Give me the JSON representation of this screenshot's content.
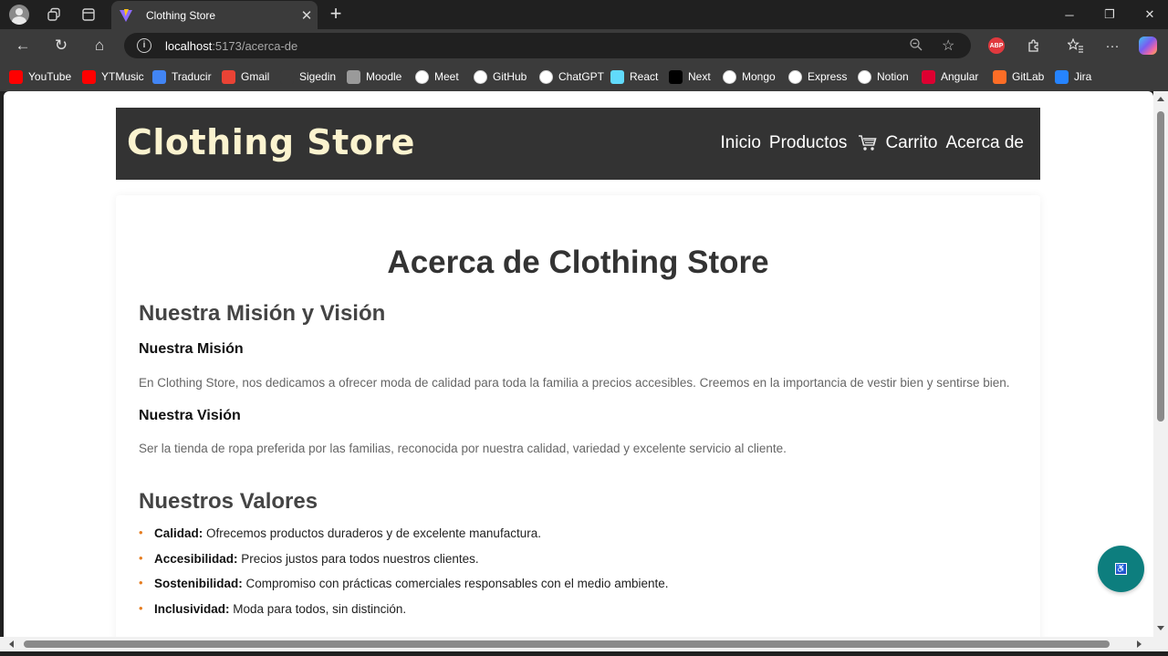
{
  "browser": {
    "tab_title": "Clothing Store",
    "url_host": "localhost",
    "url_path": ":5173/acerca-de",
    "bookmarks": [
      {
        "label": "YouTube",
        "icon": "youtube-icon",
        "color": "#ff0000"
      },
      {
        "label": "YTMusic",
        "icon": "ytmusic-icon",
        "color": "#ff0000"
      },
      {
        "label": "Traducir",
        "icon": "translate-icon",
        "color": "#4285f4"
      },
      {
        "label": "Gmail",
        "icon": "gmail-icon",
        "color": "#ea4335"
      },
      {
        "label": "Sigedin",
        "icon": "globe-icon",
        "color": "#3b3b3b"
      },
      {
        "label": "Moodle",
        "icon": "moodle-icon",
        "color": "#9a9a9a"
      },
      {
        "label": "Meet",
        "icon": "google-icon",
        "color": "#ffffff"
      },
      {
        "label": "GitHub",
        "icon": "github-icon",
        "color": "#ffffff"
      },
      {
        "label": "ChatGPT",
        "icon": "chatgpt-icon",
        "color": "#ffffff"
      },
      {
        "label": "React",
        "icon": "react-icon",
        "color": "#61dafb"
      },
      {
        "label": "Next",
        "icon": "next-icon",
        "color": "#000000"
      },
      {
        "label": "Mongo",
        "icon": "mongo-icon",
        "color": "#ffffff"
      },
      {
        "label": "Express",
        "icon": "express-icon",
        "color": "#ffffff"
      },
      {
        "label": "Notion",
        "icon": "notion-icon",
        "color": "#ffffff"
      },
      {
        "label": "Angular",
        "icon": "angular-icon",
        "color": "#dd0031"
      },
      {
        "label": "GitLab",
        "icon": "gitlab-icon",
        "color": "#fc6d26"
      },
      {
        "label": "Jira",
        "icon": "jira-icon",
        "color": "#2684ff"
      }
    ]
  },
  "site": {
    "brand": "Clothing Store",
    "nav": {
      "inicio": "Inicio",
      "productos": "Productos",
      "carrito": "Carrito",
      "acerca": "Acerca de"
    }
  },
  "about": {
    "title": "Acerca de Clothing Store",
    "section_mv": "Nuestra Misión y Visión",
    "mision_title": "Nuestra Misión",
    "mision_text": "En Clothing Store, nos dedicamos a ofrecer moda de calidad para toda la familia a precios accesibles. Creemos en la importancia de vestir bien y sentirse bien.",
    "vision_title": "Nuestra Visión",
    "vision_text": "Ser la tienda de ropa preferida por las familias, reconocida por nuestra calidad, variedad y excelente servicio al cliente.",
    "section_values": "Nuestros Valores",
    "values": [
      {
        "name": "Calidad:",
        "desc": " Ofrecemos productos duraderos y de excelente manufactura."
      },
      {
        "name": "Accesibilidad:",
        "desc": " Precios justos para todos nuestros clientes."
      },
      {
        "name": "Sostenibilidad:",
        "desc": " Compromiso con prácticas comerciales responsables con el medio ambiente."
      },
      {
        "name": "Inclusividad:",
        "desc": " Moda para todos, sin distinción."
      }
    ]
  },
  "accessibility_button": {
    "icon": "accessibility-icon",
    "color": "#0d7e7e"
  },
  "colors": {
    "header_bg": "#333333",
    "brand_text": "#fbf3cf",
    "bullet": "#e67e22"
  }
}
